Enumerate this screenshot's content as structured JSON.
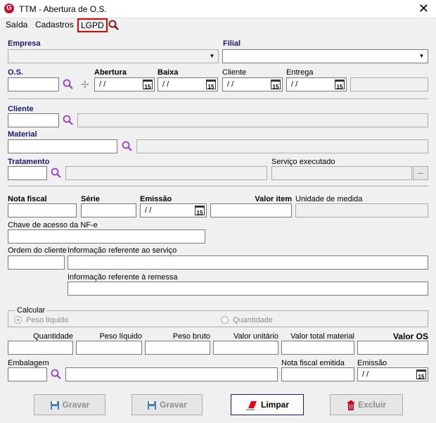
{
  "window": {
    "title": "TTM - Abertura de O.S.",
    "close": "✕",
    "icon_letter": "G"
  },
  "menu": {
    "saida": "Saída",
    "cadastros": "Cadastros",
    "lgpd": "LGPD"
  },
  "labels": {
    "empresa": "Empresa",
    "filial": "Filial",
    "os": "O.S.",
    "abertura": "Abertura",
    "baixa": "Baixa",
    "cliente_top": "Cliente",
    "entrega": "Entrega",
    "cliente": "Cliente",
    "material": "Material",
    "tratamento": "Tratamento",
    "servico_executado": "Serviço executado",
    "nota_fiscal": "Nota fiscal",
    "serie": "Série",
    "emissao": "Emissão",
    "valor_item": "Valor item",
    "unidade_medida": "Unidade de medida",
    "chave_acesso": "Chave de acesso da NF-e",
    "ordem_cliente": "Ordem do cliente",
    "info_servico": "Informação referente ao serviço",
    "info_remessa": "Informação referente à remessa",
    "calcular": "Calcular",
    "peso_liquido_radio": "Peso líquido",
    "quantidade_radio": "Quantidade",
    "quantidade": "Quantidade",
    "peso_liquido": "Peso líquido",
    "peso_bruto": "Peso bruto",
    "valor_unitario": "Valor unitário",
    "valor_total_material": "Valor total material",
    "valor_os": "Valor OS",
    "embalagem": "Embalagem",
    "nf_emitida": "Nota fiscal emitida",
    "emissao2": "Emissão"
  },
  "date_placeholder": "/ /",
  "cal_text": "15",
  "ellipsis": "...",
  "buttons": {
    "gravar1": "Gravar",
    "gravar2": "Gravar",
    "limpar": "Limpar",
    "excluir": "Excluir"
  },
  "colors": {
    "accent": "#1a1a70",
    "highlight": "#e00000",
    "search": "#9b3fc8"
  }
}
